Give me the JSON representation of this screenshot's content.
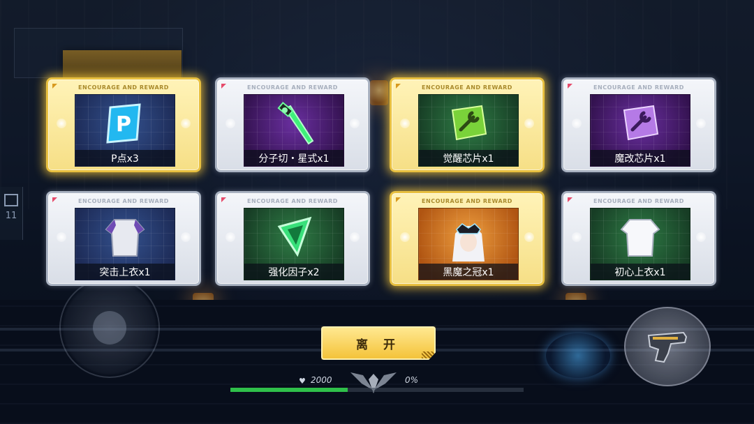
{
  "card_tag": "ENCOURAGE AND REWARD",
  "rewards": [
    {
      "label": "P点x3",
      "rarity": "gold",
      "bg": "blue",
      "icon": "p-point-icon"
    },
    {
      "label": "分子切・星式x1",
      "rarity": "silver",
      "bg": "purple",
      "icon": "energy-sword-icon"
    },
    {
      "label": "觉醒芯片x1",
      "rarity": "gold",
      "bg": "green",
      "icon": "wrench-chip-icon"
    },
    {
      "label": "魔改芯片x1",
      "rarity": "silver",
      "bg": "purple",
      "icon": "wrench-chip-icon"
    },
    {
      "label": "突击上衣x1",
      "rarity": "silver",
      "bg": "blue",
      "icon": "raglan-shirt-icon"
    },
    {
      "label": "强化因子x2",
      "rarity": "silver",
      "bg": "green",
      "icon": "green-crystal-icon"
    },
    {
      "label": "黑魔之冠x1",
      "rarity": "gold",
      "bg": "orange",
      "icon": "dark-crown-icon"
    },
    {
      "label": "初心上衣x1",
      "rarity": "silver",
      "bg": "green",
      "icon": "white-shirt-icon"
    }
  ],
  "leave_button": "离 开",
  "hud": {
    "hp_value": "2000",
    "percent": "0%",
    "left_count": "11",
    "hp_fill_fraction": 0.4
  },
  "colors": {
    "gold_border": "#e8c040",
    "silver_border": "#aab3c2",
    "button_gold": "#f4c33a"
  }
}
